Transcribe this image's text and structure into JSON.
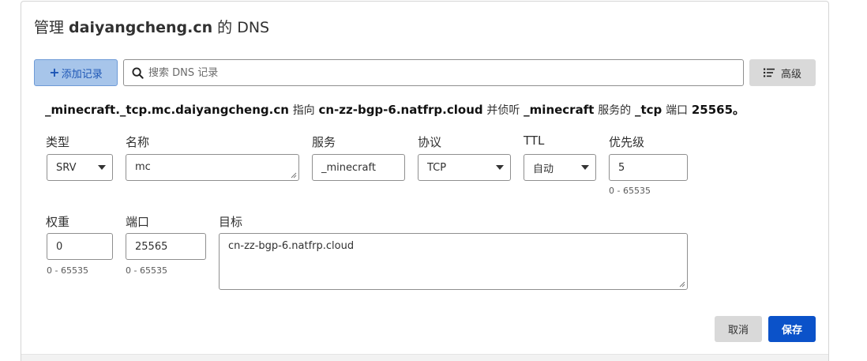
{
  "dialog": {
    "title_prefix": "管理 ",
    "domain": "daiyangcheng.cn",
    "title_suffix": " 的 DNS"
  },
  "toolbar": {
    "add_label": "添加记录",
    "search_placeholder": "搜索 DNS 记录",
    "advanced_label": "高级"
  },
  "summary": {
    "name": "_minecraft._tcp.mc.daiyangcheng.cn",
    "points_to": "指向",
    "target": "cn-zz-bgp-6.natfrp.cloud",
    "listen_word": "并侦听",
    "service": "_minecraft",
    "service_word": "服务的",
    "protocol": "_tcp",
    "port_word": "端口",
    "port": "25565",
    "end": "。"
  },
  "form": {
    "type": {
      "label": "类型",
      "value": "SRV"
    },
    "name": {
      "label": "名称",
      "value": "mc"
    },
    "service": {
      "label": "服务",
      "value": "_minecraft"
    },
    "protocol": {
      "label": "协议",
      "value": "TCP"
    },
    "ttl": {
      "label": "TTL",
      "value": "自动"
    },
    "priority": {
      "label": "优先级",
      "value": "5",
      "hint": "0 - 65535"
    },
    "weight": {
      "label": "权重",
      "value": "0",
      "hint": "0 - 65535"
    },
    "port": {
      "label": "端口",
      "value": "25565",
      "hint": "0 - 65535"
    },
    "target": {
      "label": "目标",
      "value": "cn-zz-bgp-6.natfrp.cloud"
    }
  },
  "actions": {
    "cancel_label": "取消",
    "save_label": "保存"
  },
  "colors": {
    "primary": "#0b52c9",
    "add_button_bg": "#a7c5ea"
  }
}
